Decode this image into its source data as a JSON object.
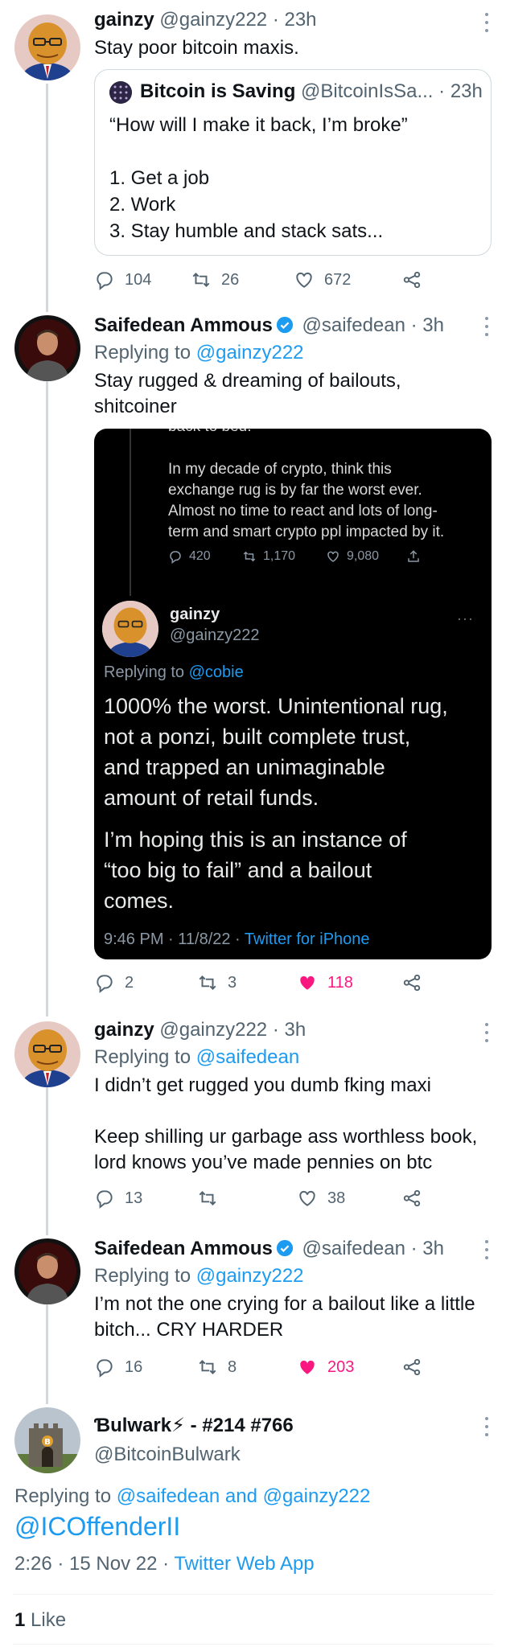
{
  "tweets": [
    {
      "name": "gainzy",
      "handle": "@gainzy222",
      "time": "· 23h",
      "text": "Stay poor bitcoin maxis.",
      "quote": {
        "name": "Bitcoin is Saving",
        "handle": "@BitcoinIsSa...",
        "time": "· 23h",
        "text": "“How will I make it back, I’m broke”\n\n1. Get a job\n2. Work\n3. Stay humble and stack sats..."
      },
      "replies": "104",
      "retweets": "26",
      "likes": "672"
    },
    {
      "name": "Saifedean Ammous",
      "handle": "@saifedean",
      "time": "· 3h",
      "replying_prefix": "Replying to",
      "replying_to": "@gainzy222",
      "text": "Stay rugged & dreaming of bailouts,\nshitcoiner",
      "replies": "2",
      "retweets": "3",
      "likes": "118",
      "embed": {
        "cut_text": "back to bed.",
        "prev_text": "In my decade of crypto, think this\nexchange rug is by far the worst ever.\nAlmost no time to react and lots of long-\nterm and smart crypto ppl impacted by it.",
        "prev_replies": "420",
        "prev_retweets": "1,170",
        "prev_likes": "9,080",
        "name": "gainzy",
        "handle": "@gainzy222",
        "replying_prefix": "Replying to",
        "replying_to": "@cobie",
        "body1": "1000% the worst. Unintentional rug,\nnot a ponzi, built complete trust,\nand trapped an unimaginable\namount of retail funds.",
        "body2": "I’m hoping this is an instance of\n“too big to fail” and a bailout\ncomes.",
        "timestamp": "9:46 PM · 11/8/22 · ",
        "source": "Twitter for iPhone"
      }
    },
    {
      "name": "gainzy",
      "handle": "@gainzy222",
      "time": "· 3h",
      "replying_prefix": "Replying to",
      "replying_to": "@saifedean",
      "text": "I didn’t get rugged you dumb fking maxi\n\nKeep shilling ur garbage ass worthless book,\nlord knows you’ve made pennies on btc",
      "replies": "13",
      "retweets": "",
      "likes": "38"
    },
    {
      "name": "Saifedean Ammous",
      "handle": "@saifedean",
      "time": "· 3h",
      "replying_prefix": "Replying to",
      "replying_to": "@gainzy222",
      "text": "I’m not the one crying for a bailout like a little\nbitch... CRY HARDER",
      "replies": "16",
      "retweets": "8",
      "likes": "203"
    }
  ],
  "main_tweet": {
    "name": "Ɓulwark⚡ - #214 #766",
    "handle": "@BitcoinBulwark",
    "replying_prefix": "Replying to",
    "replying_to": "@saifedean and @gainzy222",
    "text": "@ICOffenderII",
    "timestamp": "2:26 · 15 Nov 22 · ",
    "source": "Twitter Web App",
    "like_count": "1",
    "like_label": "Like"
  },
  "icons": [
    "reply-icon",
    "retweet-icon",
    "like-icon",
    "share-icon",
    "more-icon",
    "verified-icon"
  ],
  "colors": {
    "link": "#1d9bf0",
    "muted": "#536471",
    "like_active": "#f91880",
    "text": "#0f1419"
  }
}
